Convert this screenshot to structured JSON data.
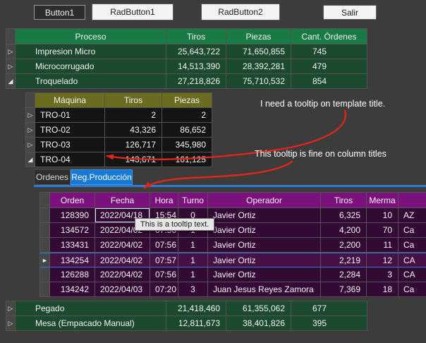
{
  "toolbar": {
    "button1": "Button1",
    "radbutton1": "RadButton1",
    "radbutton2": "RadButton2",
    "salir": "Salir"
  },
  "icons": {
    "collapsed": "▷",
    "expanded": "◢",
    "current_row": "►"
  },
  "colors": {
    "background": "#3c3c3c",
    "process_header_green": "#1a7a43",
    "process_row_green": "#1b4a2e",
    "machine_header_olive": "#6b6c1f",
    "machine_row_dark": "#141414",
    "production_header_purple": "#7b117d",
    "production_row_purple": "#320a34",
    "selection_blue": "#2e7bd6",
    "active_tab_blue": "#1879d2",
    "annotation_red": "#df261c"
  },
  "process_grid": {
    "headers": [
      "Proceso",
      "Tiros",
      "Piezas",
      "Cant. Órdenes"
    ],
    "rows_top": [
      {
        "proceso": "Impresion Micro",
        "tiros": "25,643,722",
        "piezas": "71,650,855",
        "ordenes": "745"
      },
      {
        "proceso": "Microcorrugado",
        "tiros": "14,513,390",
        "piezas": "28,392,281",
        "ordenes": "479"
      },
      {
        "proceso": "Troquelado",
        "tiros": "27,218,826",
        "piezas": "75,710,532",
        "ordenes": "854"
      }
    ],
    "rows_bottom": [
      {
        "proceso": "Pegado",
        "tiros": "21,418,460",
        "piezas": "61,355,062",
        "ordenes": "677"
      },
      {
        "proceso": "Mesa (Empacado Manual)",
        "tiros": "12,811,673",
        "piezas": "38,401,826",
        "ordenes": "395"
      }
    ]
  },
  "machine_grid": {
    "headers": [
      "Máquina",
      "Tiros",
      "Piezas"
    ],
    "rows": [
      {
        "maquina": "TRO-01",
        "tiros": "2",
        "piezas": "2"
      },
      {
        "maquina": "TRO-02",
        "tiros": "43,326",
        "piezas": "86,652"
      },
      {
        "maquina": "TRO-03",
        "tiros": "126,717",
        "piezas": "345,980"
      },
      {
        "maquina": "TRO-04",
        "tiros": "143,671",
        "piezas": "161,125"
      }
    ]
  },
  "tabs": {
    "ordenes": "Ordenes",
    "reg_produccion": "Reg.Producción"
  },
  "production_grid": {
    "headers": [
      "Orden",
      "Fecha",
      "Hora",
      "Turno",
      "Operador",
      "Tiros",
      "Merma",
      ""
    ],
    "rows": [
      {
        "orden": "128390",
        "fecha": "2022/04/18",
        "hora": "15:54",
        "turno": "0",
        "operador": "Javier Ortiz",
        "tiros": "6,325",
        "merma": "10",
        "extra": "AZ"
      },
      {
        "orden": "134572",
        "fecha": "2022/04/02",
        "hora": "07:56",
        "turno": "1",
        "operador": "Javier Ortiz",
        "tiros": "4,200",
        "merma": "70",
        "extra": "Ca"
      },
      {
        "orden": "133431",
        "fecha": "2022/04/02",
        "hora": "07:56",
        "turno": "1",
        "operador": "Javier Ortiz",
        "tiros": "2,200",
        "merma": "11",
        "extra": "Ca"
      },
      {
        "orden": "134254",
        "fecha": "2022/04/02",
        "hora": "07:57",
        "turno": "1",
        "operador": "Javier Ortiz",
        "tiros": "2,219",
        "merma": "12",
        "extra": "CA"
      },
      {
        "orden": "126288",
        "fecha": "2022/04/02",
        "hora": "07:56",
        "turno": "1",
        "operador": "Javier Ortiz",
        "tiros": "2,284",
        "merma": "3",
        "extra": "CA"
      },
      {
        "orden": "134242",
        "fecha": "2022/04/03",
        "hora": "07:20",
        "turno": "3",
        "operador": "Juan Jesus Reyes Zamora",
        "tiros": "7,369",
        "merma": "18",
        "extra": "Ca"
      }
    ]
  },
  "tooltip": {
    "text": "This is a tooltip text."
  },
  "annotations": {
    "note_template_title": "I need a tooltip on template title.",
    "note_column_titles": "This tooltip is fine on column titles"
  }
}
